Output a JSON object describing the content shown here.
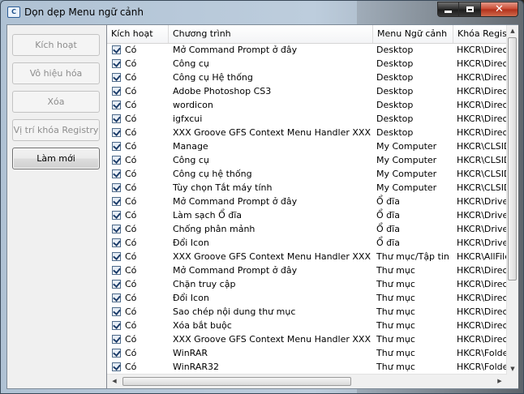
{
  "window": {
    "title": "Dọn dẹp Menu ngữ cảnh",
    "app_icon_glyph": "C"
  },
  "sidebar": {
    "buttons": [
      {
        "label": "Kích hoạt",
        "enabled": false
      },
      {
        "label": "Vô hiệu hóa",
        "enabled": false
      },
      {
        "label": "Xóa",
        "enabled": false
      },
      {
        "label": "Vị trí khóa Registry",
        "enabled": false
      },
      {
        "label": "Làm mới",
        "enabled": true
      }
    ]
  },
  "list": {
    "columns": [
      "Kích hoạt",
      "Chương trình",
      "Menu Ngữ cảnh",
      "Khóa Registy"
    ],
    "rows": [
      {
        "enabled": "Có",
        "program": "Mở Command Prompt ở đây",
        "menu": "Desktop",
        "key": "HKCR\\Directo"
      },
      {
        "enabled": "Có",
        "program": "Công cụ",
        "menu": "Desktop",
        "key": "HKCR\\Directo"
      },
      {
        "enabled": "Có",
        "program": "Công cụ Hệ thống",
        "menu": "Desktop",
        "key": "HKCR\\Directo"
      },
      {
        "enabled": "Có",
        "program": "Adobe Photoshop CS3",
        "menu": "Desktop",
        "key": "HKCR\\Directo"
      },
      {
        "enabled": "Có",
        "program": "wordicon",
        "menu": "Desktop",
        "key": "HKCR\\Directo"
      },
      {
        "enabled": "Có",
        "program": "igfxcui",
        "menu": "Desktop",
        "key": "HKCR\\Directo"
      },
      {
        "enabled": "Có",
        "program": "XXX Groove GFS Context Menu Handler XXX",
        "menu": "Desktop",
        "key": "HKCR\\Directo"
      },
      {
        "enabled": "Có",
        "program": "Manage",
        "menu": "My Computer",
        "key": "HKCR\\CLSID"
      },
      {
        "enabled": "Có",
        "program": "Công cụ",
        "menu": "My Computer",
        "key": "HKCR\\CLSID"
      },
      {
        "enabled": "Có",
        "program": "Công cụ hệ thống",
        "menu": "My Computer",
        "key": "HKCR\\CLSID"
      },
      {
        "enabled": "Có",
        "program": "Tùy chọn Tắt máy tính",
        "menu": "My Computer",
        "key": "HKCR\\CLSID"
      },
      {
        "enabled": "Có",
        "program": "Mở Command Prompt ở đây",
        "menu": "Ổ đĩa",
        "key": "HKCR\\Drive\\"
      },
      {
        "enabled": "Có",
        "program": "Làm sạch Ổ đĩa",
        "menu": "Ổ đĩa",
        "key": "HKCR\\Drive\\"
      },
      {
        "enabled": "Có",
        "program": "Chống phân mảnh",
        "menu": "Ổ đĩa",
        "key": "HKCR\\Drive\\"
      },
      {
        "enabled": "Có",
        "program": "Đổi Icon",
        "menu": "Ổ đĩa",
        "key": "HKCR\\Drive\\"
      },
      {
        "enabled": "Có",
        "program": "XXX Groove GFS Context Menu Handler XXX",
        "menu": "Thư mục/Tập tin",
        "key": "HKCR\\AllFiles"
      },
      {
        "enabled": "Có",
        "program": "Mở Command Prompt ở đây",
        "menu": "Thư mục",
        "key": "HKCR\\Directo"
      },
      {
        "enabled": "Có",
        "program": "Chặn truy cập",
        "menu": "Thư mục",
        "key": "HKCR\\Directo"
      },
      {
        "enabled": "Có",
        "program": "Đổi Icon",
        "menu": "Thư mục",
        "key": "HKCR\\Directo"
      },
      {
        "enabled": "Có",
        "program": "Sao chép nội dung thư mục",
        "menu": "Thư mục",
        "key": "HKCR\\Directo"
      },
      {
        "enabled": "Có",
        "program": "Xóa bắt buộc",
        "menu": "Thư mục",
        "key": "HKCR\\Directo"
      },
      {
        "enabled": "Có",
        "program": "XXX Groove GFS Context Menu Handler XXX",
        "menu": "Thư mục",
        "key": "HKCR\\Directo"
      },
      {
        "enabled": "Có",
        "program": "WinRAR",
        "menu": "Thư mục",
        "key": "HKCR\\Folder"
      },
      {
        "enabled": "Có",
        "program": "WinRAR32",
        "menu": "Thư mục",
        "key": "HKCR\\Folder"
      }
    ]
  },
  "icons": {
    "minimize": "minimize-icon",
    "maximize": "maximize-icon",
    "close": "close-icon",
    "checkbox": "checkbox-checked-icon",
    "scroll_up": "arrow-up-icon",
    "scroll_down": "arrow-down-icon",
    "scroll_left": "arrow-left-icon",
    "scroll_right": "arrow-right-icon"
  },
  "colors": {
    "close_button": "#c8462e",
    "list_background": "#ffffff",
    "client_background": "#f0f0f0"
  }
}
